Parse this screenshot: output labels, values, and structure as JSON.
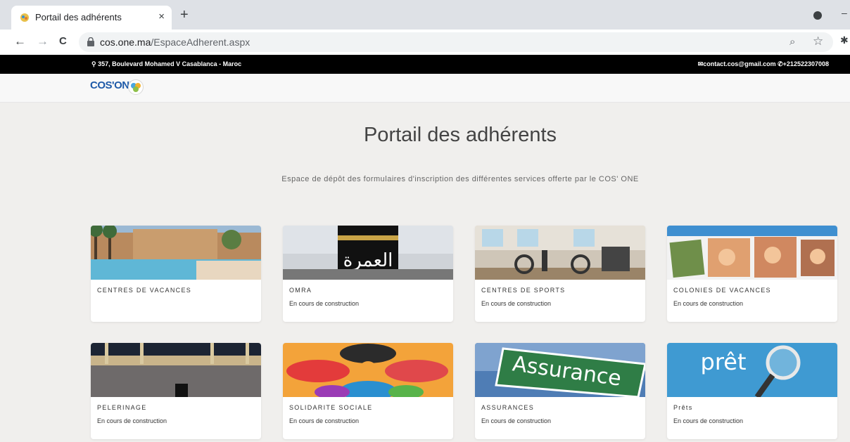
{
  "browser": {
    "tab_title": "Portail des adhérents",
    "tab_close": "×",
    "new_tab": "+",
    "url_host": "cos.one.ma",
    "url_path": "/EspaceAdherent.aspx",
    "nav_back": "←",
    "nav_forward": "→",
    "nav_reload": "C"
  },
  "topbar": {
    "address": "357, Boulevard Mohamed V Casablanca - Maroc",
    "email": "contact.cos@gmail.com",
    "phone": "+212522307008"
  },
  "logo": {
    "text": "COS'ONE"
  },
  "page": {
    "title": "Portail des adhérents",
    "subtitle": "Espace de dépôt des formulaires d'inscription des différentes services offerte par le COS' ONE"
  },
  "cards": [
    {
      "title": "CENTRES DE VACANCES",
      "desc": ""
    },
    {
      "title": "OMRA",
      "desc": "En cours de construction",
      "img_text": "العمرة"
    },
    {
      "title": "CENTRES DE SPORTS",
      "desc": "En cours de construction"
    },
    {
      "title": "COLONIES DE VACANCES",
      "desc": "En cours de construction"
    },
    {
      "title": "PELERINAGE",
      "desc": "En cours de construction"
    },
    {
      "title": "SOLIDARITE SOCIALE",
      "desc": "En cours de construction"
    },
    {
      "title": "ASSURANCES",
      "desc": "En cours de construction",
      "img_text": "Assurance"
    },
    {
      "title": "Prêts",
      "desc": "En cours de construction",
      "img_text": "prêt"
    }
  ],
  "colors": {
    "topbar_bg": "#000000",
    "page_bg": "#f0efed",
    "logo_blue": "#1e5aa8"
  }
}
